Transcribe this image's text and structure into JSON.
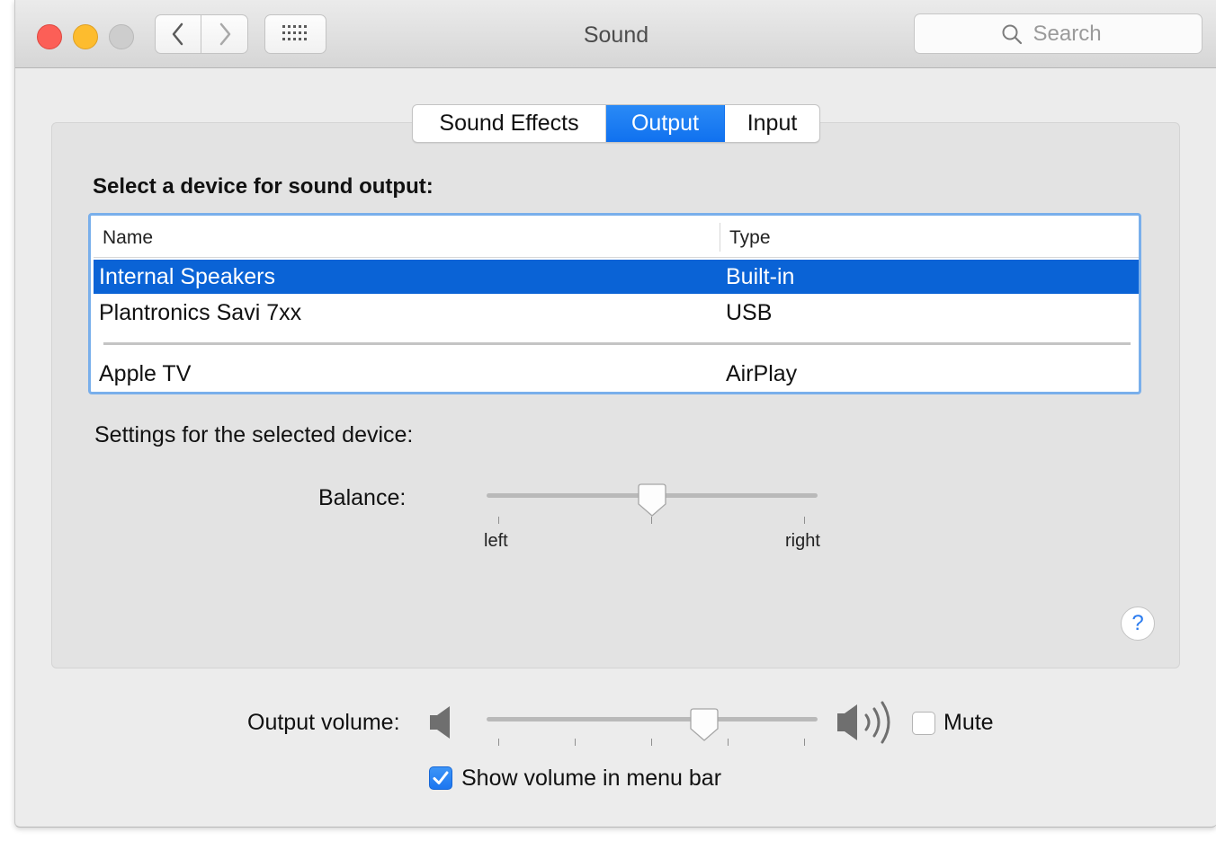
{
  "window": {
    "title": "Sound"
  },
  "toolbar": {
    "back_icon": "chevron-left-icon",
    "forward_icon": "chevron-right-icon",
    "grid_icon": "grid-icon",
    "search_placeholder": "Search"
  },
  "tabs": [
    {
      "label": "Sound Effects",
      "active": false
    },
    {
      "label": "Output",
      "active": true
    },
    {
      "label": "Input",
      "active": false
    }
  ],
  "devices": {
    "heading": "Select a device for sound output:",
    "columns": {
      "name": "Name",
      "type": "Type"
    },
    "rows": [
      {
        "name": "Internal Speakers",
        "type": "Built-in",
        "selected": true
      },
      {
        "name": "Plantronics Savi 7xx",
        "type": "USB",
        "selected": false
      },
      {
        "name": "Apple TV",
        "type": "AirPlay",
        "selected": false
      }
    ]
  },
  "settings": {
    "subheading": "Settings for the selected device:",
    "balance_label": "Balance:",
    "balance_value": 0.5,
    "balance_left": "left",
    "balance_right": "right"
  },
  "help": {
    "label": "?"
  },
  "volume": {
    "label": "Output volume:",
    "value": 0.67,
    "mute_label": "Mute",
    "mute_checked": false,
    "menubar_label": "Show volume in menu bar",
    "menubar_checked": true
  },
  "colors": {
    "accent": "#1071ef",
    "selection": "#0a63d6",
    "close": "#fc5f57",
    "minimize": "#fdbc2e",
    "zoom": "#cdcdcd"
  }
}
